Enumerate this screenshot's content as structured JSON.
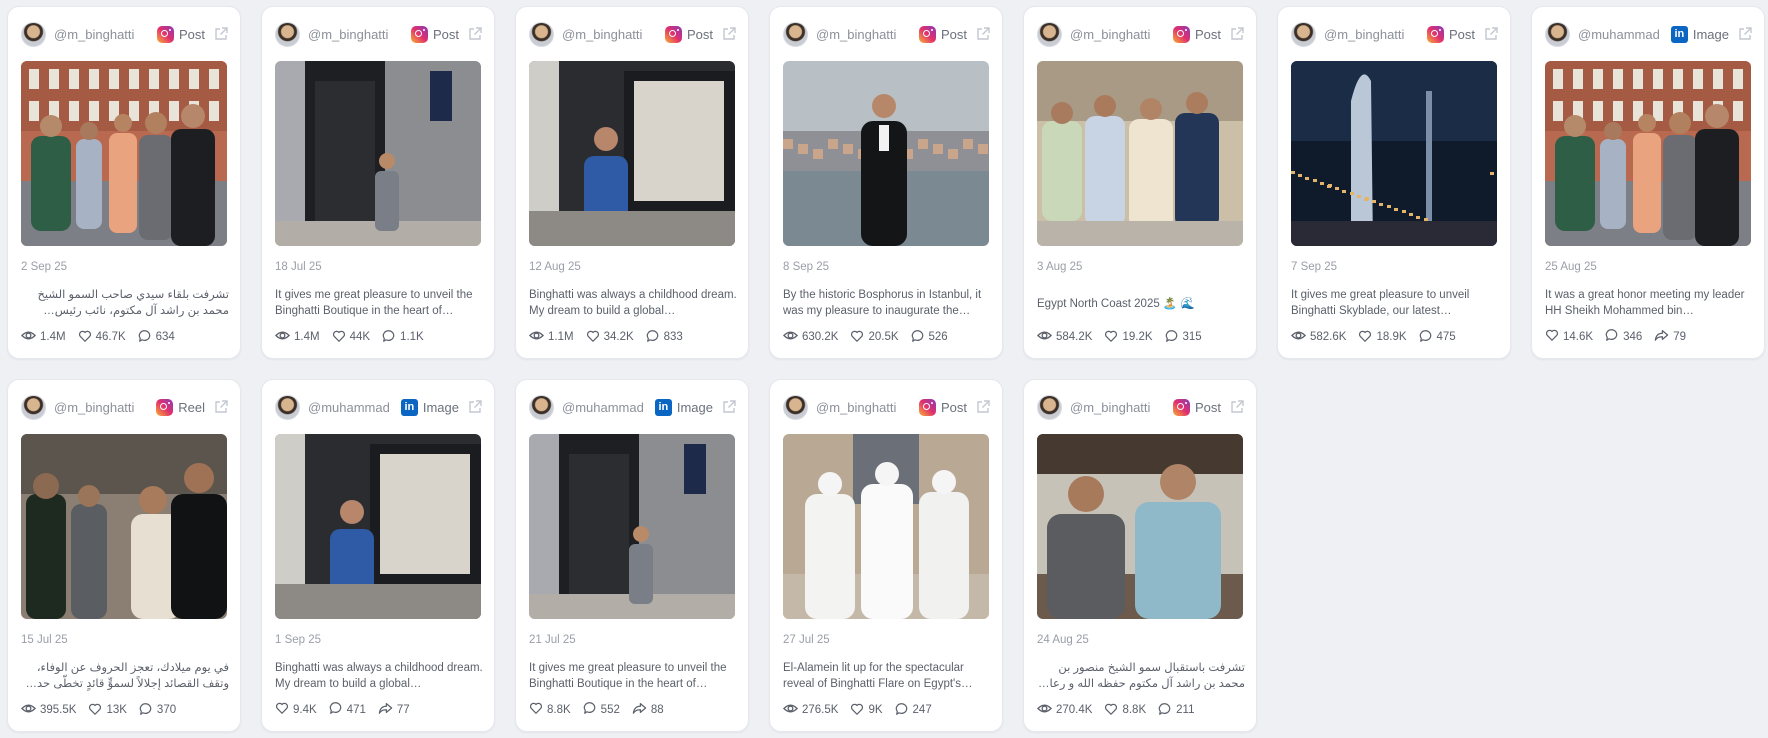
{
  "cards": [
    {
      "handle": "@m_binghatti",
      "platform": "instagram",
      "type": "Post",
      "date": "2 Sep 25",
      "caption": "تشرفت بلقاء سيدي صاحب السمو الشيخ محمد بن راشد آل مكتوم، نائب رئيس الدولة، رئيس …",
      "rtl": true,
      "views": "1.4M",
      "likes": "46.7K",
      "comments": "634"
    },
    {
      "handle": "@m_binghatti",
      "platform": "instagram",
      "type": "Post",
      "date": "18 Jul 25",
      "caption": "It gives me great pleasure to unveil the Binghatti Boutique in the heart of…",
      "views": "1.4M",
      "likes": "44K",
      "comments": "1.1K"
    },
    {
      "handle": "@m_binghatti",
      "platform": "instagram",
      "type": "Post",
      "date": "12 Aug 25",
      "caption": "Binghatti was always a childhood dream. My dream to build a global…",
      "views": "1.1M",
      "likes": "34.2K",
      "comments": "833"
    },
    {
      "handle": "@m_binghatti",
      "platform": "instagram",
      "type": "Post",
      "date": "8 Sep 25",
      "caption": "By the historic Bosphorus in Istanbul, it was my pleasure to inaugurate the…",
      "views": "630.2K",
      "likes": "20.5K",
      "comments": "526"
    },
    {
      "handle": "@m_binghatti",
      "platform": "instagram",
      "type": "Post",
      "date": "3 Aug 25",
      "caption": "Egypt North Coast 2025 🏝️ 🌊",
      "single": true,
      "views": "584.2K",
      "likes": "19.2K",
      "comments": "315"
    },
    {
      "handle": "@m_binghatti",
      "platform": "instagram",
      "type": "Post",
      "date": "7 Sep 25",
      "caption": "It gives me great pleasure to unveil Binghatti Skyblade, our latest…",
      "views": "582.6K",
      "likes": "18.9K",
      "comments": "475"
    },
    {
      "handle": "@muhammad",
      "platform": "linkedin",
      "type": "Image",
      "date": "25 Aug 25",
      "caption": "It was a great honor meeting my leader HH Sheikh Mohammed bin…",
      "likes": "14.6K",
      "comments": "346",
      "shares": "79"
    },
    {
      "handle": "@m_binghatti",
      "platform": "instagram",
      "type": "Reel",
      "date": "15 Jul 25",
      "caption": "في يوم ميلادك، تعجز الحروف عن الوفاء، وتقف القصائد إجلالاً لسموٍّ قائدٍ تخطّى حدود المستحيل …",
      "rtl": true,
      "views": "395.5K",
      "likes": "13K",
      "comments": "370"
    },
    {
      "handle": "@muhammad",
      "platform": "linkedin",
      "type": "Image",
      "date": "1 Sep 25",
      "caption": "Binghatti was always a childhood dream. My dream to build a global…",
      "likes": "9.4K",
      "comments": "471",
      "shares": "77"
    },
    {
      "handle": "@muhammad",
      "platform": "linkedin",
      "type": "Image",
      "date": "21 Jul 25",
      "caption": "It gives me great pleasure to unveil the Binghatti Boutique in the heart of…",
      "likes": "8.8K",
      "comments": "552",
      "shares": "88"
    },
    {
      "handle": "@m_binghatti",
      "platform": "instagram",
      "type": "Post",
      "date": "27 Jul 25",
      "caption": "El-Alamein lit up for the spectacular reveal of Binghatti Flare on Egypt's…",
      "views": "276.5K",
      "likes": "9K",
      "comments": "247"
    },
    {
      "handle": "@m_binghatti",
      "platform": "instagram",
      "type": "Post",
      "date": "24 Aug 25",
      "caption": "تشرفت باستقبال سمو الشيخ منصور بن محمد بن راشد آل مكتوم حفظه الله و رعاه في جلسة …",
      "rtl": true,
      "views": "270.4K",
      "likes": "8.8K",
      "comments": "211"
    }
  ],
  "icons": {
    "instagram": "instagram-icon",
    "linkedin": "linkedin-icon",
    "open": "external-link-icon",
    "views": "eye-icon",
    "likes": "heart-icon",
    "comments": "comment-icon",
    "shares": "share-icon"
  },
  "colors": {
    "linkedin": "#0a66c2",
    "instagram_gradient": [
      "#f9b233",
      "#e1306c",
      "#8a3ab9"
    ]
  }
}
